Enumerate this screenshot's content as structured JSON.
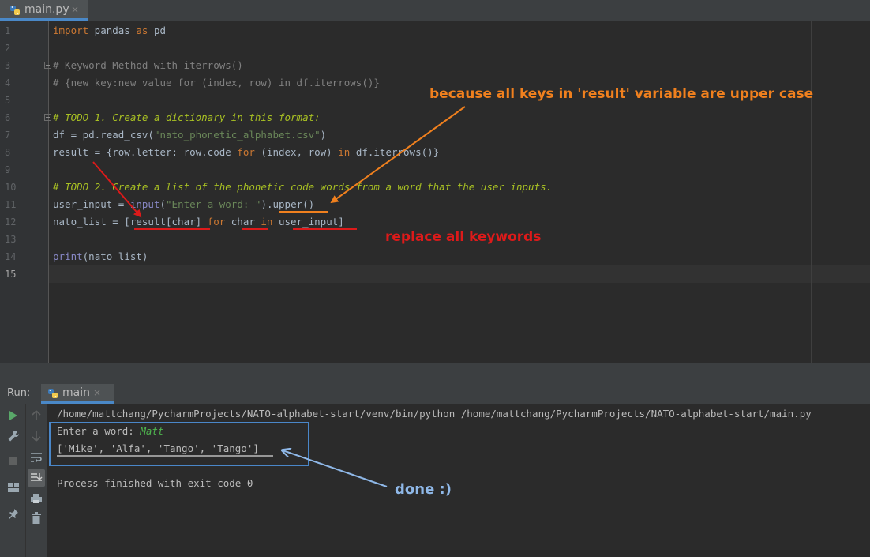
{
  "editor_tab": {
    "filename": "main.py",
    "close": "×"
  },
  "code": {
    "line_numbers": [
      "1",
      "2",
      "3",
      "4",
      "5",
      "6",
      "7",
      "8",
      "9",
      "10",
      "11",
      "12",
      "13",
      "14",
      "15"
    ],
    "l1_kw1": "import",
    "l1_mod": " pandas ",
    "l1_kw2": "as",
    "l1_alias": " pd",
    "l3": "# Keyword Method with iterrows()",
    "l4": "# {new_key:new_value for (index, row) in df.iterrows()}",
    "l6_hash": "# ",
    "l6_todo": "TODO 1. Create a dictionary in this format:",
    "l7_a": "df = pd.read_csv(",
    "l7_str": "\"nato_phonetic_alphabet.csv\"",
    "l7_b": ")",
    "l8_a": "result = {row.letter: row.code ",
    "l8_for": "for",
    "l8_b": " (index, row) ",
    "l8_in": "in",
    "l8_c": " df.iterrows()}",
    "l10_hash": "# ",
    "l10_todo": "TODO 2. Create a list of the phonetic code words from a word that the user inputs.",
    "l11_a": "user_input = ",
    "l11_fn": "input",
    "l11_b": "(",
    "l11_str": "\"Enter a word: \"",
    "l11_c": ").upper()",
    "l12_a": "nato_list = [result[char] ",
    "l12_for": "for",
    "l12_b": " char ",
    "l12_in": "in",
    "l12_c": " user_input]",
    "l14_fn": "print",
    "l14_b": "(nato_list)"
  },
  "annotations": {
    "upper": "because all keys in 'result' variable are upper case",
    "replace": "replace all keywords",
    "done": "done :)"
  },
  "run_panel": {
    "label": "Run:",
    "tab": "main",
    "close": "×",
    "command": "/home/mattchang/PycharmProjects/NATO-alphabet-start/venv/bin/python /home/mattchang/PycharmProjects/NATO-alphabet-start/main.py",
    "prompt": "Enter a word: ",
    "user_input": "Matt",
    "result": "['Mike', 'Alfa', 'Tango', 'Tango']",
    "exit": "Process finished with exit code 0"
  },
  "colors": {
    "annotation_orange": "#f0801e",
    "annotation_red": "#dd1a1a",
    "annotation_blue": "#8fb8e8",
    "box_blue": "#4a87c9"
  }
}
